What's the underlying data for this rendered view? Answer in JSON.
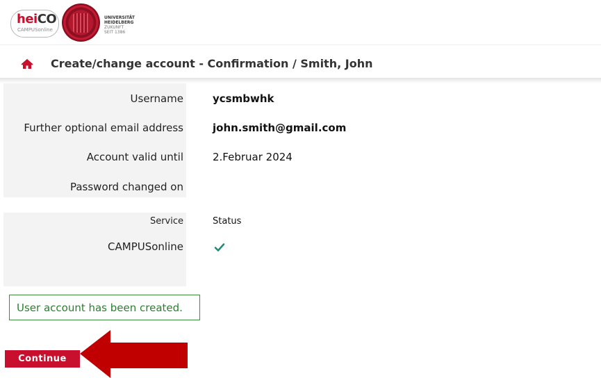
{
  "header": {
    "heico_logo": {
      "hei": "hei",
      "co": "CO",
      "sub": "CAMPUSonline"
    },
    "university": {
      "line1": "UNIVERSITÄT",
      "line2": "HEIDELBERG",
      "line3": "ZUKUNFT",
      "line4": "SEIT 1386"
    },
    "home_icon": "home-icon",
    "title": "Create/change account - Confirmation  / Smith, John"
  },
  "account": {
    "fields": [
      {
        "label": "Username",
        "value": "ycsmbwhk"
      },
      {
        "label": "Further optional email address",
        "value": "john.smith@gmail.com"
      },
      {
        "label": "Account valid until",
        "value": "2.Februar 2024"
      },
      {
        "label": "Password changed on",
        "value": ""
      }
    ]
  },
  "services": {
    "header": {
      "service": "Service",
      "status": "Status"
    },
    "rows": [
      {
        "service": "CAMPUSonline",
        "status_icon": "check-icon"
      }
    ]
  },
  "message": "User account has been created.",
  "continue_label": "Continue",
  "colors": {
    "brand_red": "#c8102e",
    "success_green": "#2e7d32",
    "check_teal": "#2a8a78",
    "label_bg": "#f3f3f3"
  }
}
